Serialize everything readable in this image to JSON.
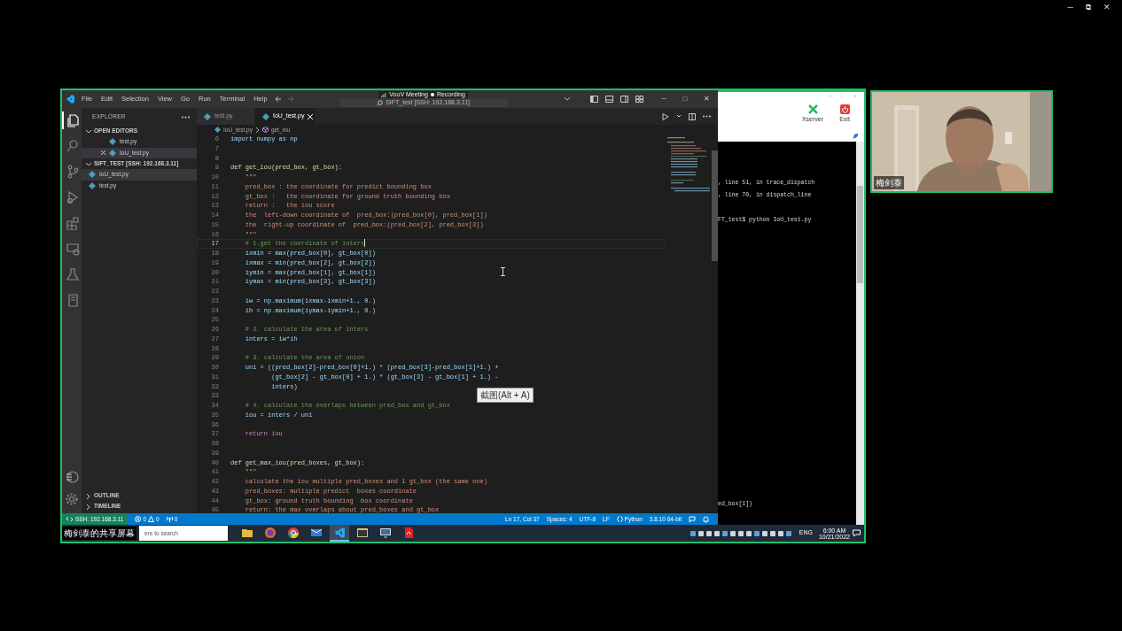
{
  "meeting_window_controls": [
    "─",
    "⧉",
    "✕"
  ],
  "recording_badge": {
    "app": "VooV Meeting",
    "status": "Recording"
  },
  "vscode": {
    "menu": [
      "File",
      "Edit",
      "Selection",
      "View",
      "Go",
      "Run",
      "Terminal",
      "Help"
    ],
    "command_center": "SIFT_test [SSH: 192.168.3.11]",
    "window_controls": [
      "─",
      "□",
      "✕"
    ],
    "activity_bar": [
      {
        "kind": "files",
        "selected": true
      },
      {
        "kind": "search",
        "selected": false
      },
      {
        "kind": "source",
        "selected": false
      },
      {
        "kind": "debug",
        "selected": false
      },
      {
        "kind": "extensions",
        "selected": false
      },
      {
        "kind": "remote",
        "selected": false
      },
      {
        "kind": "flask",
        "selected": false
      },
      {
        "kind": "notebook",
        "selected": false
      }
    ],
    "explorer": {
      "title": "EXPLORER",
      "sections": [
        {
          "title": "OPEN EDITORS",
          "expanded": true,
          "items": [
            {
              "label": "test.py",
              "selected": false,
              "closable": false
            },
            {
              "label": "IoU_test.py",
              "selected": true,
              "closable": true
            }
          ]
        },
        {
          "title": "SIFT_TEST [SSH: 192.168.3.11]",
          "expanded": true,
          "items": [
            {
              "label": "IoU_test.py",
              "selected": true,
              "closable": false
            },
            {
              "label": "test.py",
              "selected": false,
              "closable": false
            }
          ]
        }
      ],
      "footer_sections": [
        {
          "title": "OUTLINE",
          "expanded": false
        },
        {
          "title": "TIMELINE",
          "expanded": false
        }
      ]
    },
    "tabs": [
      {
        "label": "test.py",
        "selected": false
      },
      {
        "label": "IoU_test.py",
        "selected": true
      }
    ],
    "breadcrumb": [
      "IoU_test.py",
      "get_iou"
    ],
    "code_lines": [
      {
        "no": "6",
        "kind": "code",
        "text": "import numpy as np",
        "current": false
      },
      {
        "no": "7",
        "kind": "blank",
        "current": false
      },
      {
        "no": "8",
        "kind": "blank",
        "current": false
      },
      {
        "no": "9",
        "kind": "def",
        "text": "def get_iou(pred_box, gt_box):",
        "current": false
      },
      {
        "no": "10",
        "kind": "docstring",
        "text": "    \"\"\"",
        "current": false
      },
      {
        "no": "11",
        "kind": "docstring",
        "text": "    pred_box : the coordinate for predict bounding box",
        "current": false
      },
      {
        "no": "12",
        "kind": "docstring",
        "text": "    gt_box :   the coordinate for ground truth bounding box",
        "current": false
      },
      {
        "no": "13",
        "kind": "docstring",
        "text": "    return :   the iou score",
        "current": false
      },
      {
        "no": "14",
        "kind": "docstring",
        "text": "    the  left-down coordinate of  pred_box:(pred_box[0], pred_box[1])",
        "current": false
      },
      {
        "no": "15",
        "kind": "docstring",
        "text": "    the  right-up coordinate of  pred_box:(pred_box[2], pred_box[3])",
        "current": false
      },
      {
        "no": "16",
        "kind": "docstring",
        "text": "    \"\"\"",
        "current": false
      },
      {
        "no": "17",
        "kind": "comment",
        "text": "    # 1.get the coordinate of inters",
        "current": true
      },
      {
        "no": "18",
        "kind": "code",
        "text": "    ixmin = max(pred_box[0], gt_box[0])",
        "current": false
      },
      {
        "no": "19",
        "kind": "code",
        "text": "    ixmax = min(pred_box[2], gt_box[2])",
        "current": false
      },
      {
        "no": "20",
        "kind": "code",
        "text": "    iymin = max(pred_box[1], gt_box[1])",
        "current": false
      },
      {
        "no": "21",
        "kind": "code",
        "text": "    iymax = min(pred_box[3], gt_box[3])",
        "current": false
      },
      {
        "no": "22",
        "kind": "blank",
        "current": false
      },
      {
        "no": "23",
        "kind": "code",
        "text": "    iw = np.maximum(ixmax-ixmin+1., 0.)",
        "current": false
      },
      {
        "no": "24",
        "kind": "code",
        "text": "    ih = np.maximum(iymax-iymin+1., 0.)",
        "current": false
      },
      {
        "no": "25",
        "kind": "blank",
        "current": false
      },
      {
        "no": "26",
        "kind": "comment",
        "text": "    # 2. calculate the area of inters",
        "current": false
      },
      {
        "no": "27",
        "kind": "code",
        "text": "    inters = iw*ih",
        "current": false
      },
      {
        "no": "28",
        "kind": "blank",
        "current": false
      },
      {
        "no": "29",
        "kind": "comment",
        "text": "    # 3. calculate the area of union",
        "current": false
      },
      {
        "no": "30",
        "kind": "code",
        "text": "    uni = ((pred_box[2]-pred_box[0]+1.) * (pred_box[3]-pred_box[1]+1.) +",
        "current": false
      },
      {
        "no": "31",
        "kind": "code",
        "text": "           (gt_box[2] - gt_box[0] + 1.) * (gt_box[3] - gt_box[1] + 1.) -",
        "current": false
      },
      {
        "no": "32",
        "kind": "code",
        "text": "           inters)",
        "current": false
      },
      {
        "no": "33",
        "kind": "blank",
        "current": false
      },
      {
        "no": "34",
        "kind": "comment",
        "text": "    # 4. calculate the overlaps between pred_box and gt_box",
        "current": false
      },
      {
        "no": "35",
        "kind": "code",
        "text": "    iou = inters / uni",
        "current": false
      },
      {
        "no": "36",
        "kind": "blank",
        "current": false
      },
      {
        "no": "37",
        "kind": "keyword",
        "text": "    return iou",
        "current": false
      },
      {
        "no": "38",
        "kind": "blank",
        "current": false
      },
      {
        "no": "39",
        "kind": "blank",
        "current": false
      },
      {
        "no": "40",
        "kind": "def",
        "text": "def get_max_iou(pred_boxes, gt_box):",
        "current": false
      },
      {
        "no": "41",
        "kind": "docstring",
        "text": "    \"\"\"",
        "current": false
      },
      {
        "no": "42",
        "kind": "docstring",
        "text": "    calculate the iou multiple pred_boxes and 1 gt_box (the same one)",
        "current": false
      },
      {
        "no": "43",
        "kind": "docstring",
        "text": "    pred_boxes: multiple predict  boxes coordinate",
        "current": false
      },
      {
        "no": "44",
        "kind": "docstring",
        "text": "    gt_box: ground truth bounding  box coordinate",
        "current": false
      },
      {
        "no": "45",
        "kind": "docstring",
        "text": "    return: the max overlaps about pred_boxes and gt_box",
        "current": false
      }
    ],
    "tooltip": "截图(Alt + A)",
    "status_bar": {
      "remote": "SSH: 192.168.3.11",
      "errors": "0",
      "warnings": "0",
      "ports": "0",
      "right": [
        {
          "kind": "text",
          "text": "Ln 17, Col 37"
        },
        {
          "kind": "text",
          "text": "Spaces: 4"
        },
        {
          "kind": "text",
          "text": "UTF-8"
        },
        {
          "kind": "text",
          "text": "LF"
        },
        {
          "kind": "language",
          "text": "Python"
        },
        {
          "kind": "text",
          "text": "3.8.10 64-bit"
        }
      ]
    }
  },
  "xserver_window": {
    "window_controls": [
      "─",
      "□",
      "×"
    ],
    "buttons": [
      {
        "label": "Xserver",
        "kind": "xserver"
      },
      {
        "label": "Exit",
        "kind": "exit"
      }
    ],
    "terminal_lines": [
      ", line 51, in trace_dispatch",
      ", line 70, in dispatch_line",
      "FT_test$ python IoU_test.py",
      "ed_box[1])"
    ]
  },
  "taskbar": {
    "share_label": "梅剑泰的共享屏幕",
    "search_placeholder": "ere to search",
    "apps": [
      {
        "kind": "folder",
        "selected": false
      },
      {
        "kind": "globe",
        "selected": false
      },
      {
        "kind": "wheel",
        "selected": false
      },
      {
        "kind": "envelope",
        "selected": false
      },
      {
        "kind": "ribbon",
        "selected": true
      },
      {
        "kind": "window",
        "selected": false
      },
      {
        "kind": "monitor",
        "selected": false
      },
      {
        "kind": "document",
        "selected": false
      }
    ],
    "language": "ENG",
    "time": "6:00 AM",
    "date": "10/21/2022"
  },
  "webcam": {
    "kind": "picture",
    "name": "梅剑泰"
  }
}
